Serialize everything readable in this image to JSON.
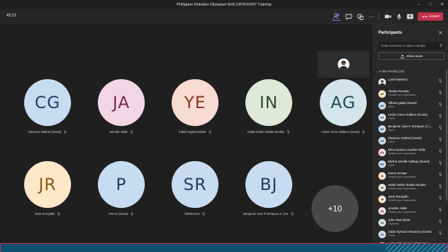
{
  "window": {
    "title": "Philippine Robotics Olympiad SHS CATEGORY Training"
  },
  "toolbar": {
    "timer": "45:51",
    "leave_label": "Leave",
    "icons": [
      "people-icon",
      "chat-icon",
      "reactions-icon",
      "more-icon",
      "camera-icon",
      "mic-icon",
      "share-icon",
      "phone-icon"
    ]
  },
  "tiles": [
    {
      "initials": "CG",
      "name": "Clarence Gabriel (Guest)",
      "color": "#c7dcf0",
      "text": "#1f3f66"
    },
    {
      "initials": "JA",
      "name": "Jennifer Abille",
      "color": "#f3d6e3",
      "text": "#7a2a4a"
    },
    {
      "initials": "YE",
      "name": "Yuibel Angela Emblle",
      "color": "#f9dcd1",
      "text": "#8a3321"
    },
    {
      "initials": "IN",
      "name": "Isaiah Seifer Abellar Nicolas",
      "color": "#e0e8d9",
      "text": "#33492a"
    },
    {
      "initials": "AG",
      "name": "Andrei Vince Gallano (Guest)",
      "color": "#d3e5ea",
      "text": "#1f4a57"
    },
    {
      "initials": "JR",
      "name": "Jacie Ronquillo",
      "color": "#fde7c8",
      "text": "#8a5a17"
    },
    {
      "initials": "P",
      "name": "Prince (Guest)",
      "color": "#c7dcf0",
      "text": "#1f3f66"
    },
    {
      "initials": "SR",
      "name": "Sheila Rosi",
      "color": "#c7dcf0",
      "text": "#1f3f66"
    },
    {
      "initials": "BJ",
      "name": "Benjamin Jose P. Enriquez Jr. (Gu",
      "color": "#c7dcf0",
      "text": "#1f3f66"
    }
  ],
  "overflow_count": "+10",
  "panel": {
    "title": "Participants",
    "invite_placeholder": "Invite someone or dial a number",
    "share_invite": "Share invite",
    "section_label": "In this meeting (20)",
    "participants": [
      {
        "name": "Loriel Martinez",
        "status": "",
        "initials": "LM",
        "color": "#e8e8e8",
        "photo": true
      },
      {
        "name": "Alosha Florante",
        "status": "Outside your organization",
        "initials": "AF",
        "color": "#fde7c8"
      },
      {
        "name": "Alfredo gadia (Guest)",
        "status": "Guest",
        "initials": "AG",
        "color": "#c7dcf0"
      },
      {
        "name": "Andrei Vince Gallano (Guest)",
        "status": "Guest",
        "initials": "AG",
        "color": "#d3e5ea"
      },
      {
        "name": "Benjamin Jose P. Enriquez Jr. (...",
        "status": "Guest",
        "initials": "BJ",
        "color": "#c7dcf0"
      },
      {
        "name": "Clarence Gabriel (Guest)",
        "status": "Guest",
        "initials": "CG",
        "color": "#c7dcf0"
      },
      {
        "name": "Elmo Denise Licudine Abille",
        "status": "Outside your organization",
        "initials": "EA",
        "color": "#f3d6e3"
      },
      {
        "name": "Elysha Jemille Gallego (Guest)",
        "status": "Guest",
        "initials": "EG",
        "color": "#c7dcf0"
      },
      {
        "name": "Iemeo Serape",
        "status": "Outside your organization",
        "initials": "IS",
        "color": "#fde7c8"
      },
      {
        "name": "Isaiah Seifer Abellar Nicolas",
        "status": "Outside your organization",
        "initials": "IN",
        "color": "#e0e8d9"
      },
      {
        "name": "Jacie Ronquillo",
        "status": "Outside your organization",
        "initials": "JR",
        "color": "#fde7c8"
      },
      {
        "name": "Jennifer Abille",
        "status": "Outside your organization",
        "initials": "JA",
        "color": "#f3d6e3"
      },
      {
        "name": "John Paul Obina",
        "status": "Organizer",
        "initials": "JO",
        "color": "#d3e5ea"
      },
      {
        "name": "Julian Eymard Venancio (Guest)",
        "status": "Guest",
        "initials": "JV",
        "color": "#c7dcf0"
      },
      {
        "name": "LHEA MIE MAGLANGBAYAN",
        "status": "",
        "initials": "LM",
        "color": "#f3d6e3"
      }
    ]
  }
}
